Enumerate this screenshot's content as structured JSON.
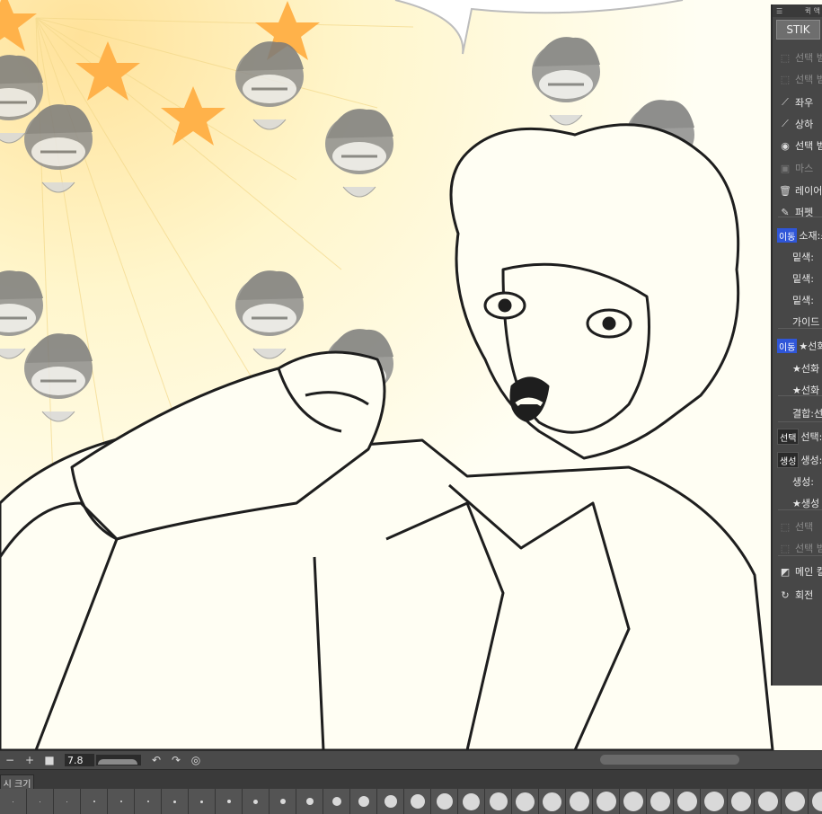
{
  "quick_access": {
    "header": "퀵 액",
    "set_name": "STIK",
    "items": [
      {
        "label": "선택 범",
        "enabled": false,
        "icon": "marquee-icon"
      },
      {
        "label": "선택 범",
        "enabled": false,
        "icon": "marquee-icon"
      },
      {
        "label": "좌우",
        "enabled": true,
        "icon": "flip-horizontal-icon"
      },
      {
        "label": "상하",
        "enabled": true,
        "icon": "flip-vertical-icon"
      },
      {
        "label": "선택 범",
        "enabled": true,
        "icon": "selection-circle-icon"
      },
      {
        "label": "마스",
        "enabled": false,
        "icon": "mask-icon"
      },
      {
        "label": "레이어",
        "enabled": true,
        "icon": "trash-icon"
      },
      {
        "label": "퍼펫",
        "enabled": true,
        "icon": "puppet-warp-icon"
      },
      {
        "tag": "이동",
        "label": "소재:소",
        "enabled": true
      },
      {
        "label": "밑색:",
        "enabled": true
      },
      {
        "label": "밑색:",
        "enabled": true
      },
      {
        "label": "밑색:",
        "enabled": true
      },
      {
        "label": "가이드",
        "enabled": true
      },
      {
        "tag": "이동",
        "label": "★선화",
        "enabled": true
      },
      {
        "label": "★선화",
        "enabled": true
      },
      {
        "label": "★선화",
        "enabled": true
      },
      {
        "label": "결합:선",
        "enabled": true
      },
      {
        "tag": "선택",
        "label": "선택:관",
        "enabled": true
      },
      {
        "tag": "생성",
        "label": "생성:",
        "enabled": true
      },
      {
        "label": "생성:",
        "enabled": true
      },
      {
        "label": "★생성",
        "enabled": true
      },
      {
        "label": "선택",
        "enabled": false,
        "icon": "marquee-icon"
      },
      {
        "label": "선택 범",
        "enabled": false,
        "icon": "marquee-icon"
      },
      {
        "label": "메인 컬",
        "enabled": true,
        "icon": "color-swap-icon"
      },
      {
        "label": "회전",
        "enabled": true,
        "icon": "rotate-icon"
      }
    ]
  },
  "navigator": {
    "minus": "−",
    "plus": "+",
    "zoom_value": "7.8"
  },
  "brush_size": {
    "tab_label": "시 크기"
  },
  "colors": {
    "canvas_bg": "#fffef3",
    "panel_bg": "#474747",
    "tag_blue": "#2f56d8",
    "star_orange": "#ffb24a"
  }
}
